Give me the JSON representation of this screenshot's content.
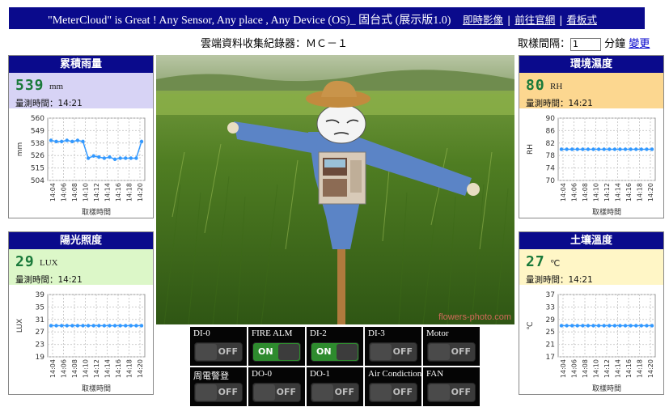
{
  "header": {
    "title": "\"MeterCloud\" is Great ! Any Sensor, Any place , Any Device (OS)_ 固台式 (展示版1.0)",
    "links": [
      "即時影像",
      "前往官網",
      "看板式"
    ],
    "separator": "|"
  },
  "logger_title": "雲端資料收集紀錄器：ＭＣ－１",
  "interval": {
    "label": "取樣間隔：",
    "value": "1",
    "unit": "分鐘",
    "change_label": "變更"
  },
  "panels": [
    {
      "title": "累積雨量",
      "value": "539",
      "unit": "mm",
      "time": "量測時間：14:21",
      "header_bg": "#d7d3f5",
      "chart_data": {
        "type": "line",
        "ylabel": "mm",
        "xlabel": "取樣時間",
        "ylim": [
          504,
          560
        ],
        "yticks": [
          "560",
          "549",
          "538",
          "526",
          "515",
          "504"
        ],
        "xticks": [
          "14:04",
          "14:06",
          "14:08",
          "14:10",
          "14:12",
          "14:14",
          "14:16",
          "14:18",
          "14:20"
        ],
        "x": [
          1,
          2,
          3,
          4,
          5,
          6,
          7,
          8,
          9,
          10,
          11,
          12,
          13,
          14,
          15,
          16,
          17,
          18
        ],
        "values": [
          540,
          539,
          539,
          540,
          539,
          540,
          539,
          524,
          526,
          525,
          524,
          525,
          523,
          524,
          524,
          524,
          524,
          539
        ]
      }
    },
    {
      "title": "環境濕度",
      "value": "80",
      "unit": "RH",
      "time": "量測時間：14:21",
      "header_bg": "#fcd790",
      "chart_data": {
        "type": "line",
        "ylabel": "RH",
        "xlabel": "取樣時間",
        "ylim": [
          70,
          90
        ],
        "yticks": [
          "90",
          "86",
          "82",
          "78",
          "74",
          "70"
        ],
        "xticks": [
          "14:04",
          "14:06",
          "14:08",
          "14:10",
          "14:12",
          "14:14",
          "14:16",
          "14:18",
          "14:20"
        ],
        "x": [
          1,
          2,
          3,
          4,
          5,
          6,
          7,
          8,
          9,
          10,
          11,
          12,
          13,
          14,
          15,
          16,
          17,
          18
        ],
        "values": [
          80,
          80,
          80,
          80,
          80,
          80,
          80,
          80,
          80,
          80,
          80,
          80,
          80,
          80,
          80,
          80,
          80,
          80
        ]
      }
    },
    {
      "title": "陽光照度",
      "value": "29",
      "unit": "LUX",
      "time": "量測時間：14:21",
      "header_bg": "#dcf7c8",
      "chart_data": {
        "type": "line",
        "ylabel": "LUX",
        "xlabel": "取樣時間",
        "ylim": [
          19,
          39
        ],
        "yticks": [
          "39",
          "35",
          "31",
          "27",
          "23",
          "19"
        ],
        "xticks": [
          "14:04",
          "14:06",
          "14:08",
          "14:10",
          "14:12",
          "14:14",
          "14:16",
          "14:18",
          "14:20"
        ],
        "x": [
          1,
          2,
          3,
          4,
          5,
          6,
          7,
          8,
          9,
          10,
          11,
          12,
          13,
          14,
          15,
          16,
          17,
          18
        ],
        "values": [
          29,
          29,
          29,
          29,
          29,
          29,
          29,
          29,
          29,
          29,
          29,
          29,
          29,
          29,
          29,
          29,
          29,
          29
        ]
      }
    },
    {
      "title": "土壤溫度",
      "value": "27",
      "unit": "℃",
      "time": "量測時間：14:21",
      "header_bg": "#fff6c6",
      "chart_data": {
        "type": "line",
        "ylabel": "℃",
        "xlabel": "取樣時間",
        "ylim": [
          17,
          37
        ],
        "yticks": [
          "37",
          "33",
          "29",
          "25",
          "21",
          "17"
        ],
        "xticks": [
          "14:04",
          "14:06",
          "14:08",
          "14:10",
          "14:12",
          "14:14",
          "14:16",
          "14:18",
          "14:20"
        ],
        "x": [
          1,
          2,
          3,
          4,
          5,
          6,
          7,
          8,
          9,
          10,
          11,
          12,
          13,
          14,
          15,
          16,
          17,
          18
        ],
        "values": [
          27,
          27,
          27,
          27,
          27,
          27,
          27,
          27,
          27,
          27,
          27,
          27,
          27,
          27,
          27,
          27,
          27,
          27
        ]
      }
    }
  ],
  "photo": {
    "watermark": "flowers-photo.com"
  },
  "io": [
    {
      "label": "DI-0",
      "state": "OFF",
      "on": false
    },
    {
      "label": "FIRE ALM",
      "state": "ON",
      "on": true
    },
    {
      "label": "DI-2",
      "state": "ON",
      "on": true
    },
    {
      "label": "DI-3",
      "state": "OFF",
      "on": false
    },
    {
      "label": "Motor",
      "state": "OFF",
      "on": false
    },
    {
      "label": "周電警登",
      "state": "OFF",
      "on": false
    },
    {
      "label": "DO-0",
      "state": "OFF",
      "on": false
    },
    {
      "label": "DO-1",
      "state": "OFF",
      "on": false
    },
    {
      "label": "Air Condiction",
      "state": "OFF",
      "on": false
    },
    {
      "label": "FAN",
      "state": "OFF",
      "on": false
    }
  ],
  "colors": {
    "header": "#0a0a8c",
    "value_green": "#1a7a3a",
    "series": "#3399ff",
    "on_green": "#2e8b2e"
  }
}
